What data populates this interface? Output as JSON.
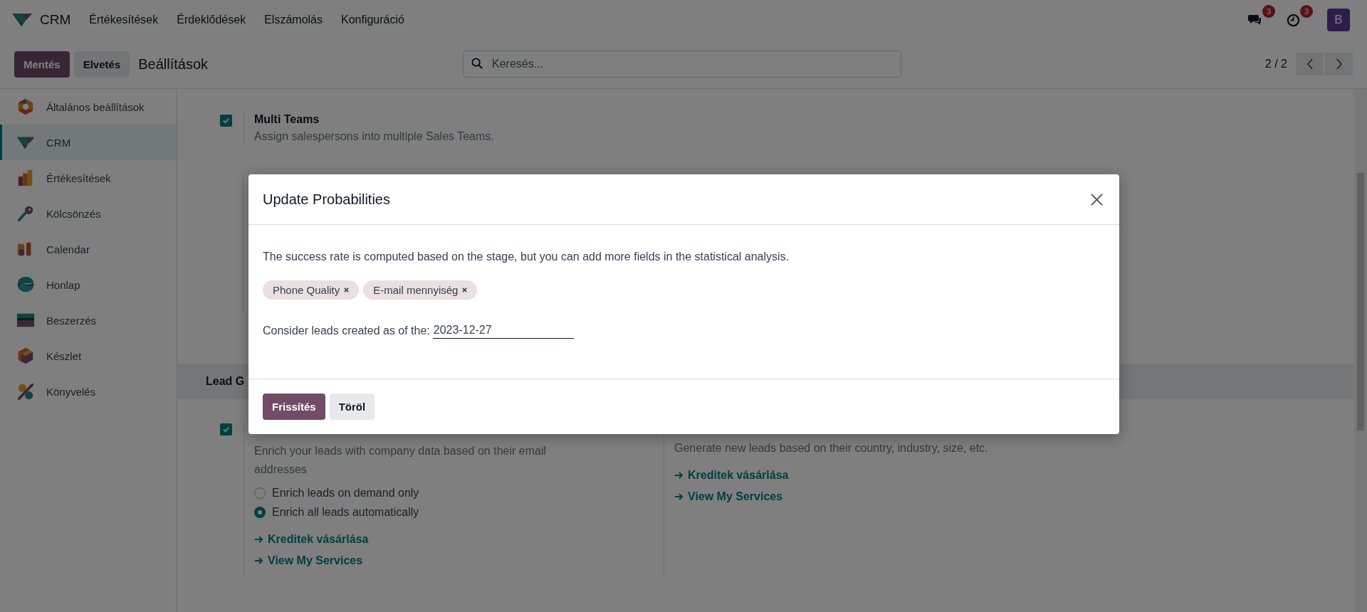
{
  "navbar": {
    "app_name": "CRM",
    "menu": [
      "Értékesítések",
      "Érdeklődések",
      "Elszámolás",
      "Konfiguráció"
    ],
    "messages_badge": "3",
    "activities_badge": "3",
    "avatar": "B"
  },
  "control_panel": {
    "buttons": [
      {
        "label": "Mentés",
        "kind": "primary"
      },
      {
        "label": "Elvetés",
        "kind": "secondary"
      }
    ],
    "breadcrumb": "Beállítások",
    "search": {
      "placeholder": "Keresés..."
    },
    "pager": "2 / 2"
  },
  "sidebar": {
    "items": [
      {
        "label": "Általános beállítások",
        "selected": false
      },
      {
        "label": "CRM",
        "selected": true
      },
      {
        "label": "Értékesítések",
        "selected": false
      },
      {
        "label": "Kölcsönzés",
        "selected": false
      },
      {
        "label": "Calendar",
        "selected": false
      },
      {
        "label": "Honlap",
        "selected": false
      },
      {
        "label": "Beszerzés",
        "selected": false
      },
      {
        "label": "Készlet",
        "selected": false
      },
      {
        "label": "Könyvelés",
        "selected": false
      }
    ]
  },
  "settings": {
    "multi_teams": {
      "checked": true,
      "title": "Multi Teams",
      "description": "Assign salespersons into multiple Sales Teams."
    },
    "section_title": "Lead G",
    "enrichment": {
      "checked": true,
      "description": "Enrich your leads with company data based on their email addresses",
      "options": [
        {
          "label": "Enrich leads on demand only",
          "selected": false
        },
        {
          "label": "Enrich all leads automatically",
          "selected": true
        }
      ],
      "links": [
        "Kreditek vásárlása",
        "View My Services"
      ]
    },
    "generation": {
      "description": "Generate new leads based on their country, industry, size, etc.",
      "links": [
        "Kreditek vásárlása",
        "View My Services"
      ]
    }
  },
  "modal": {
    "title": "Update Probabilities",
    "text": "The success rate is computed based on the stage, but you can add more fields in the statistical analysis.",
    "tags": [
      "Phone Quality",
      "E-mail mennyiség"
    ],
    "date_label": "Consider leads created as of the:",
    "date_value": "2023-12-27",
    "buttons": [
      {
        "label": "Frissítés",
        "kind": "primary"
      },
      {
        "label": "Töröl",
        "kind": "secondary"
      }
    ]
  }
}
